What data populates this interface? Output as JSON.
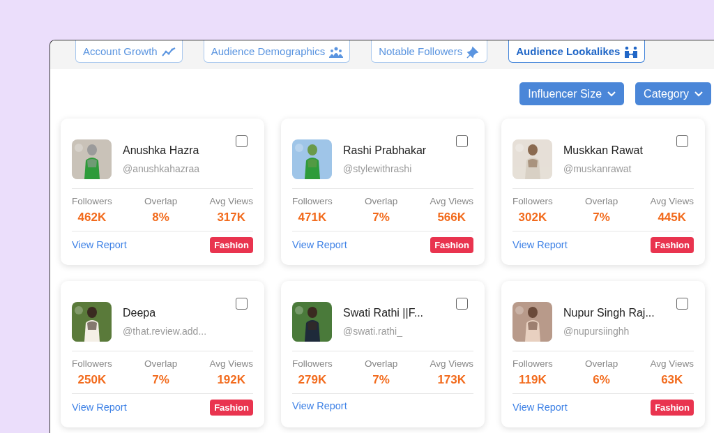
{
  "tabs": [
    {
      "label": "Account Growth",
      "selected": false
    },
    {
      "label": "Audience Demographics",
      "selected": false
    },
    {
      "label": "Notable Followers",
      "selected": false
    },
    {
      "label": "Audience Lookalikes",
      "selected": true
    }
  ],
  "filters": [
    {
      "label": "Influencer Size"
    },
    {
      "label": "Category"
    }
  ],
  "cards": [
    {
      "name": "Anushka Hazra",
      "handle": "@anushkahazraa",
      "checked": false,
      "stats": [
        {
          "label": "Followers",
          "value": "462K"
        },
        {
          "label": "Overlap",
          "value": "8%"
        },
        {
          "label": "Avg Views",
          "value": "317K"
        }
      ],
      "link": "View Report",
      "tag": "Fashion"
    },
    {
      "name": "Rashi Prabhakar",
      "handle": "@stylewithrashi",
      "checked": false,
      "stats": [
        {
          "label": "Followers",
          "value": "471K"
        },
        {
          "label": "Overlap",
          "value": "7%"
        },
        {
          "label": "Avg Views",
          "value": "566K"
        }
      ],
      "link": "View Report",
      "tag": "Fashion"
    },
    {
      "name": "Muskkan Rawat",
      "handle": "@muskanrawat",
      "checked": false,
      "stats": [
        {
          "label": "Followers",
          "value": "302K"
        },
        {
          "label": "Overlap",
          "value": "7%"
        },
        {
          "label": "Avg Views",
          "value": "445K"
        }
      ],
      "link": "View Report",
      "tag": "Fashion"
    },
    {
      "name": "Deepa",
      "handle": "@that.review.add...",
      "checked": false,
      "stats": [
        {
          "label": "Followers",
          "value": "250K"
        },
        {
          "label": "Overlap",
          "value": "7%"
        },
        {
          "label": "Avg Views",
          "value": "192K"
        }
      ],
      "link": "View Report",
      "tag": "Fashion"
    },
    {
      "name": "Swati Rathi ||F...",
      "handle": "@swati.rathi_",
      "checked": false,
      "stats": [
        {
          "label": "Followers",
          "value": "279K"
        },
        {
          "label": "Overlap",
          "value": "7%"
        },
        {
          "label": "Avg Views",
          "value": "173K"
        }
      ],
      "link": "View Report"
    },
    {
      "name": "Nupur Singh Raj...",
      "handle": "@nupursiinghh",
      "checked": false,
      "stats": [
        {
          "label": "Followers",
          "value": "119K"
        },
        {
          "label": "Overlap",
          "value": "6%"
        },
        {
          "label": "Avg Views",
          "value": "63K"
        }
      ],
      "link": "View Report",
      "tag": "Fashion"
    }
  ]
}
